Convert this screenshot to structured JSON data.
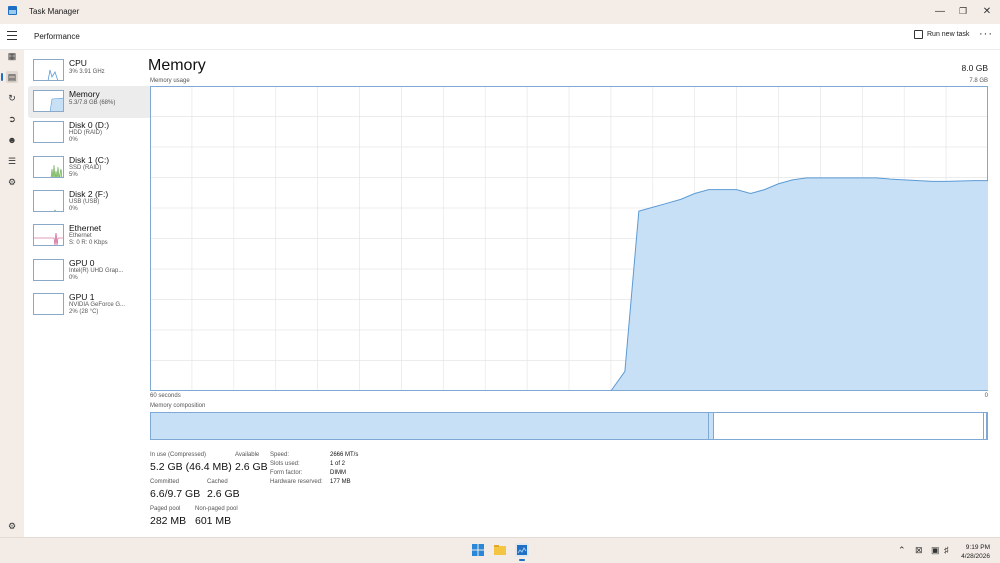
{
  "window": {
    "title": "Task Manager"
  },
  "header": {
    "page": "Performance",
    "run_new_task": "Run new task",
    "more": "···"
  },
  "resources": [
    {
      "name": "CPU",
      "sub1": "3%  3.91 GHz",
      "sub2": ""
    },
    {
      "name": "Memory",
      "sub1": "5.3/7.8 GB (68%)",
      "sub2": ""
    },
    {
      "name": "Disk 0 (D:)",
      "sub1": "HDD (RAID)",
      "sub2": "0%"
    },
    {
      "name": "Disk 1 (C:)",
      "sub1": "SSD (RAID)",
      "sub2": "5%"
    },
    {
      "name": "Disk 2 (F:)",
      "sub1": "USB (USB)",
      "sub2": "0%"
    },
    {
      "name": "Ethernet",
      "sub1": "Ethernet",
      "sub2": "S: 0  R: 0 Kbps"
    },
    {
      "name": "GPU 0",
      "sub1": "Intel(R) UHD Grap...",
      "sub2": "0%"
    },
    {
      "name": "GPU 1",
      "sub1": "NVIDIA GeForce G...",
      "sub2": "2% (28 °C)"
    }
  ],
  "detail": {
    "title": "Memory",
    "total": "8.0 GB",
    "usage_label": "Memory usage",
    "usage_max": "7.8 GB",
    "axis_left": "60 seconds",
    "axis_right": "0",
    "composition_label": "Memory composition",
    "stats": {
      "in_use_label": "In use (Compressed)",
      "in_use_value": "5.2 GB (46.4 MB)",
      "available_label": "Available",
      "available_value": "2.6 GB",
      "committed_label": "Committed",
      "committed_value": "6.6/9.7 GB",
      "cached_label": "Cached",
      "cached_value": "2.6 GB",
      "paged_label": "Paged pool",
      "paged_value": "282 MB",
      "nonpaged_label": "Non-paged pool",
      "nonpaged_value": "601 MB"
    },
    "hw": {
      "speed_label": "Speed:",
      "speed_value": "2666 MT/s",
      "slots_label": "Slots used:",
      "slots_value": "1 of 2",
      "form_label": "Form factor:",
      "form_value": "DIMM",
      "reserved_label": "Hardware reserved:",
      "reserved_value": "177 MB"
    }
  },
  "chart_data": {
    "type": "area",
    "x": [
      60,
      56,
      52,
      48,
      44,
      40,
      36,
      34,
      33,
      32,
      30,
      28,
      27,
      26,
      25,
      24,
      23,
      22,
      21,
      20,
      19,
      18,
      17,
      16,
      15,
      14,
      13,
      12,
      11,
      10,
      9,
      8,
      7,
      6,
      5,
      4,
      3,
      2,
      1,
      0
    ],
    "values": [
      0,
      0,
      0,
      0,
      0,
      0,
      0,
      0,
      0,
      0,
      0,
      0,
      0,
      0.5,
      4.6,
      4.7,
      4.8,
      4.9,
      5.05,
      5.15,
      5.15,
      5.15,
      5.05,
      5.15,
      5.3,
      5.4,
      5.45,
      5.45,
      5.45,
      5.45,
      5.45,
      5.45,
      5.42,
      5.4,
      5.38,
      5.36,
      5.36,
      5.37,
      5.38,
      5.38
    ],
    "ylim": [
      0,
      7.8
    ],
    "xlim": [
      60,
      0
    ],
    "grid": true,
    "color": "#c8e0f6",
    "line_color": "#5b9bd5"
  },
  "composition": [
    {
      "name": "In use",
      "fraction": 0.668,
      "color": "#c8e0f6"
    },
    {
      "name": "Modified",
      "fraction": 0.006,
      "color": "#c8e0f6"
    },
    {
      "name": "Standby",
      "fraction": 0.322,
      "color": "#ffffff"
    },
    {
      "name": "Free",
      "fraction": 0.004,
      "color": "#ffffff"
    }
  ],
  "taskbar": {
    "time": "9:19 PM",
    "date": "4/28/2026"
  },
  "colors": {
    "accent": "#1f6fc4",
    "graph_fill": "#c8e0f6",
    "graph_line": "#5b9bd5",
    "grid": "#e6e6e6"
  }
}
